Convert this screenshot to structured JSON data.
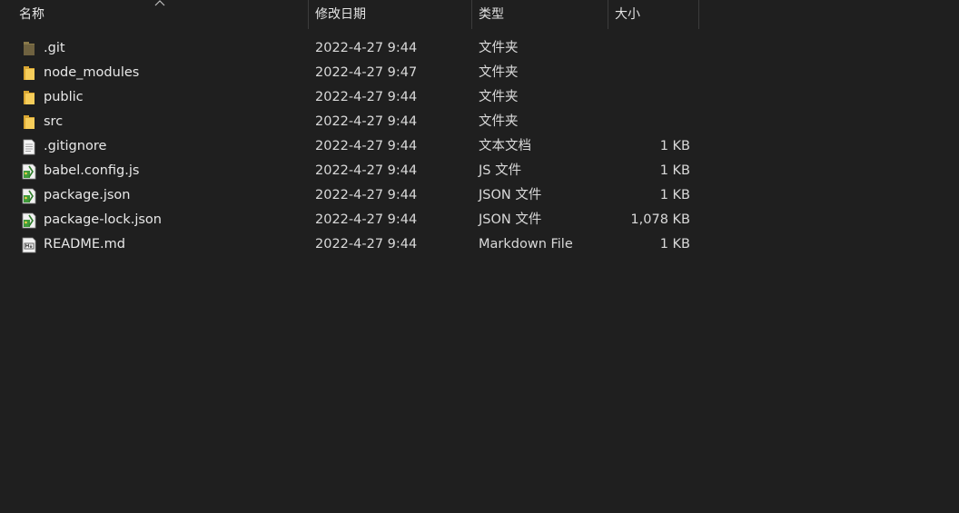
{
  "columns": {
    "name": "名称",
    "date": "修改日期",
    "type": "类型",
    "size": "大小"
  },
  "sort": {
    "column": "name",
    "direction": "ascending",
    "icon": "sort-up-arrow-icon"
  },
  "files": [
    {
      "name": ".git",
      "date": "2022-4-27 9:44",
      "type": "文件夹",
      "size": "",
      "icon": "folder-git-icon"
    },
    {
      "name": "node_modules",
      "date": "2022-4-27 9:47",
      "type": "文件夹",
      "size": "",
      "icon": "folder-icon"
    },
    {
      "name": "public",
      "date": "2022-4-27 9:44",
      "type": "文件夹",
      "size": "",
      "icon": "folder-icon"
    },
    {
      "name": "src",
      "date": "2022-4-27 9:44",
      "type": "文件夹",
      "size": "",
      "icon": "folder-icon"
    },
    {
      "name": ".gitignore",
      "date": "2022-4-27 9:44",
      "type": "文本文档",
      "size": "1 KB",
      "icon": "text-document-icon"
    },
    {
      "name": "babel.config.js",
      "date": "2022-4-27 9:44",
      "type": "JS 文件",
      "size": "1 KB",
      "icon": "script-file-icon"
    },
    {
      "name": "package.json",
      "date": "2022-4-27 9:44",
      "type": "JSON 文件",
      "size": "1 KB",
      "icon": "script-file-icon"
    },
    {
      "name": "package-lock.json",
      "date": "2022-4-27 9:44",
      "type": "JSON 文件",
      "size": "1,078 KB",
      "icon": "script-file-icon"
    },
    {
      "name": "README.md",
      "date": "2022-4-27 9:44",
      "type": "Markdown File",
      "size": "1 KB",
      "icon": "markdown-file-icon"
    }
  ],
  "colors": {
    "background": "#1f1f1f",
    "text": "#e8e8e8",
    "divider": "#3c3c3c",
    "folder": "#f0c54a",
    "folder_git": "#8a7a4a"
  }
}
